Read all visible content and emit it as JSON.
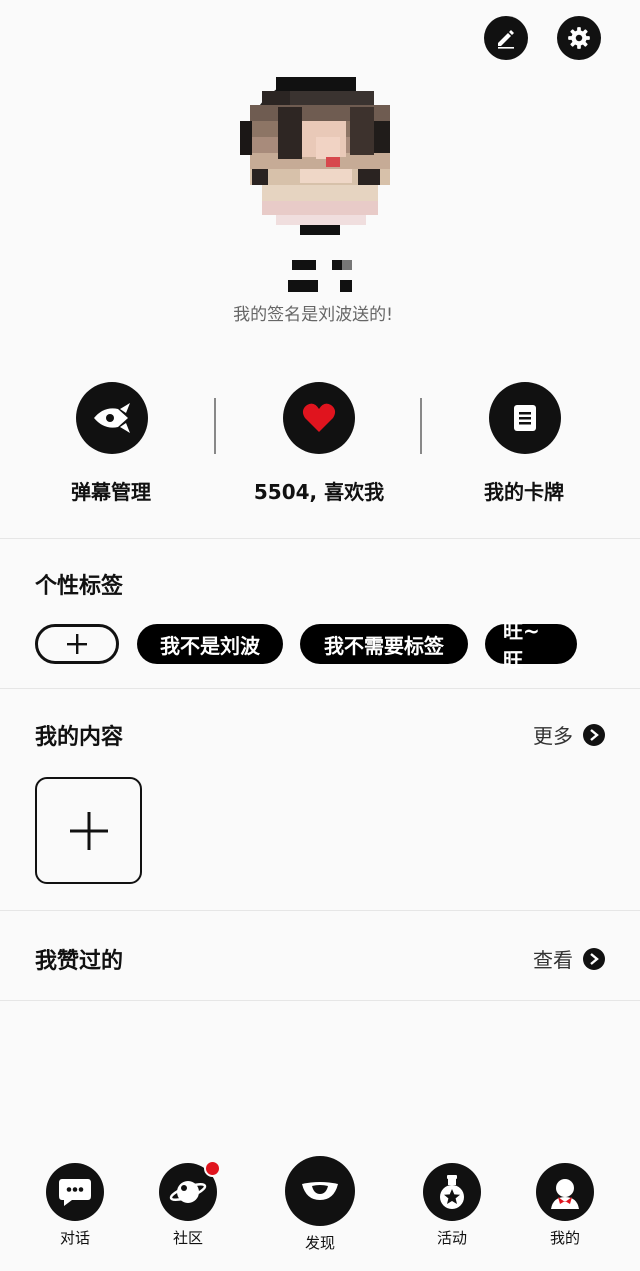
{
  "header": {
    "edit_icon": "pencil-icon",
    "settings_icon": "gear-icon"
  },
  "profile": {
    "signature": "我的签名是刘波送的!"
  },
  "stats": [
    {
      "label": "弹幕管理",
      "icon": "rocket-icon"
    },
    {
      "label": "5504, 喜欢我",
      "icon": "heart-icon",
      "accent": "#e0141e"
    },
    {
      "label": "我的卡牌",
      "icon": "card-icon"
    }
  ],
  "tags": {
    "title": "个性标签",
    "items": [
      "我不是刘波",
      "我不需要标签",
      "旺~旺"
    ]
  },
  "content": {
    "title": "我的内容",
    "more_label": "更多"
  },
  "liked": {
    "title": "我赞过的",
    "view_label": "查看"
  },
  "bottom_nav": [
    {
      "label": "对话",
      "icon": "chat-bubble-icon"
    },
    {
      "label": "社区",
      "icon": "planet-icon",
      "badge_color": "#e0141e"
    },
    {
      "label": "发现",
      "icon": "discover-eye-icon"
    },
    {
      "label": "活动",
      "icon": "potion-icon"
    },
    {
      "label": "我的",
      "icon": "user-avatar-icon"
    }
  ],
  "colors": {
    "accent": "#e0141e",
    "primary": "#111111",
    "background": "#fafafa"
  }
}
